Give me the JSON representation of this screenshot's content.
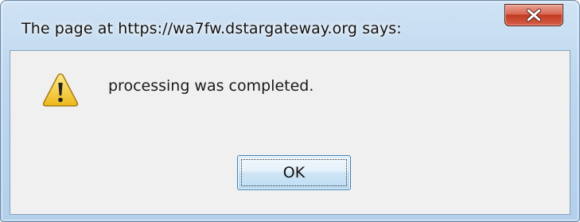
{
  "dialog": {
    "title": "The page at https://wa7fw.dstargateway.org says:",
    "close_icon": "close-icon",
    "warning_icon": "warning-icon",
    "message": "processing was completed.",
    "ok_label": "OK"
  },
  "colors": {
    "titlebar": "#bcd6ee",
    "close_button": "#c13b21",
    "client_background": "#f0f0f0",
    "warning_fill": "#f6d54a",
    "ok_border": "#3c7fb1"
  }
}
